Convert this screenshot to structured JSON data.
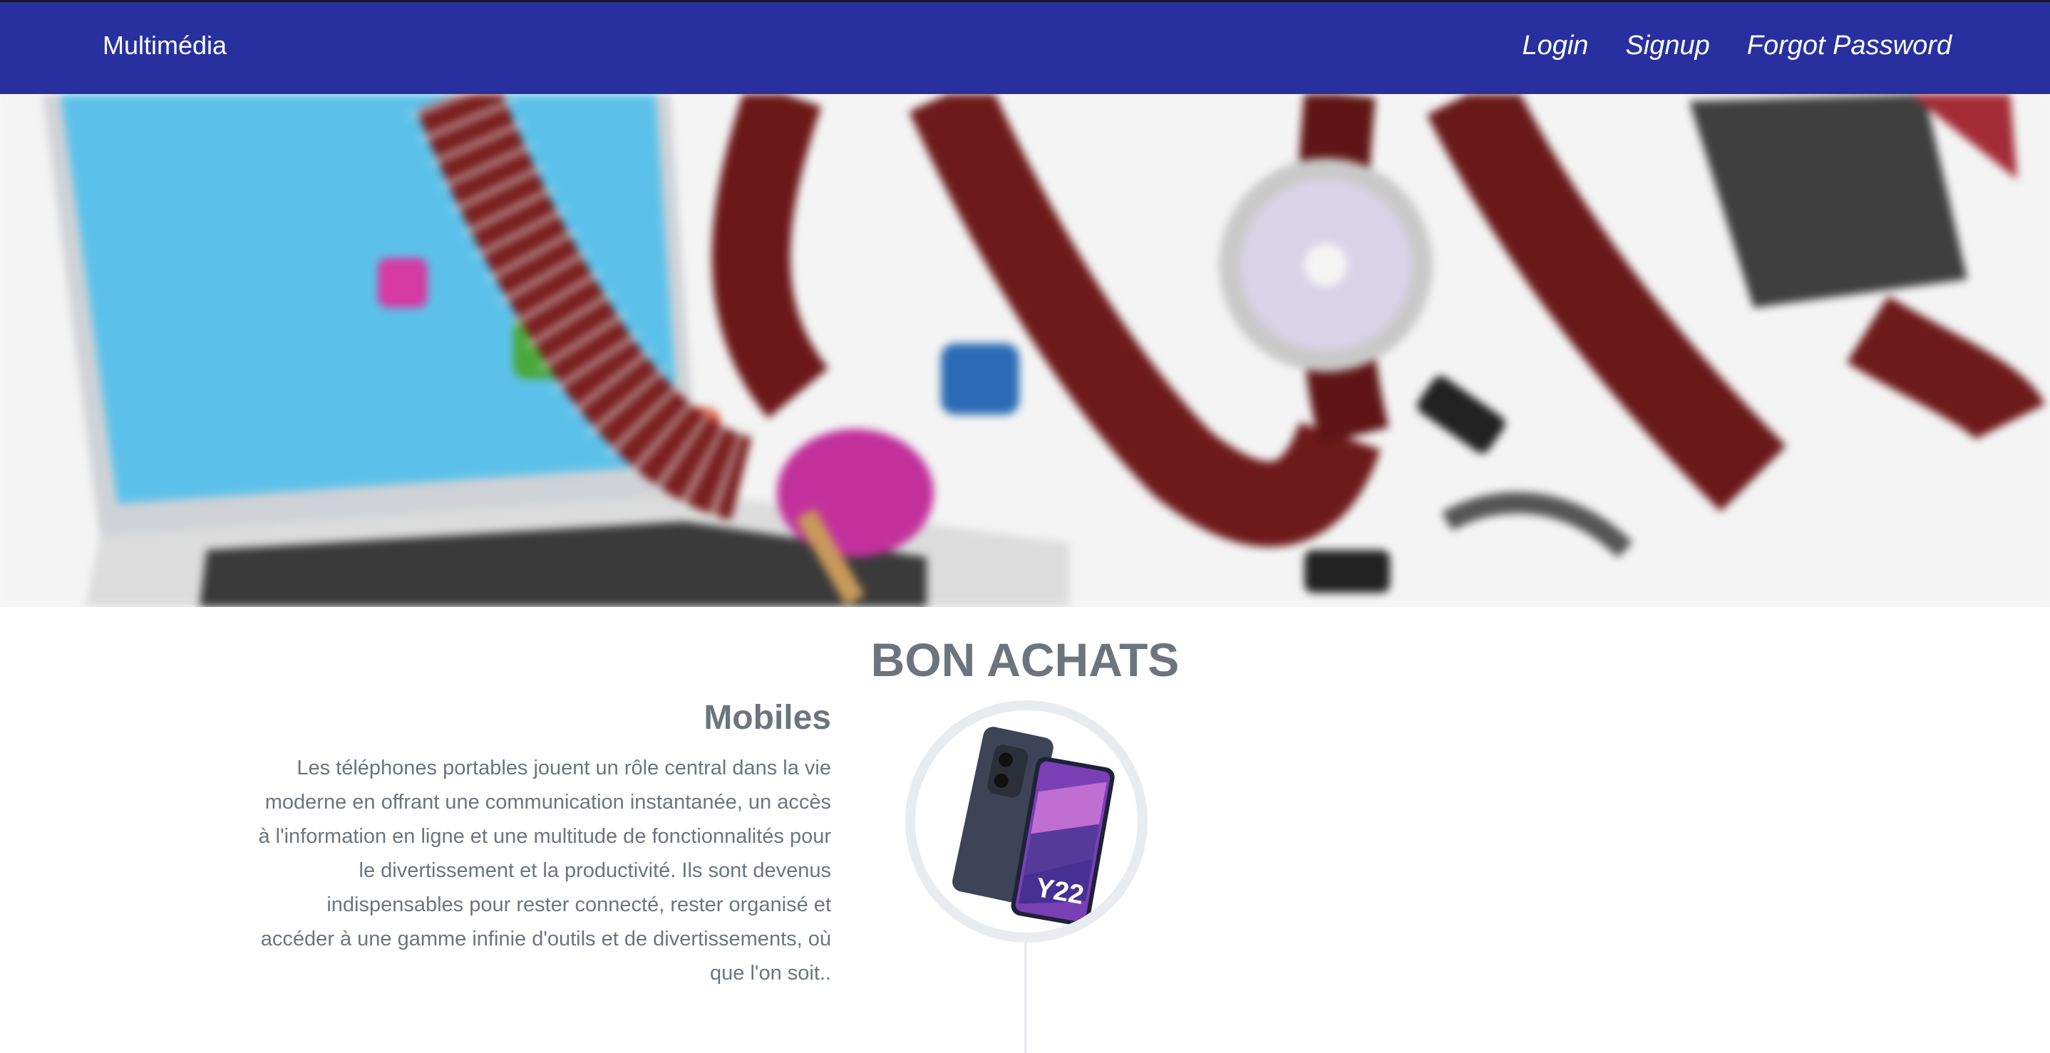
{
  "navbar": {
    "brand": "Multimédia",
    "links": [
      "Login",
      "Signup",
      "Forgot Password"
    ],
    "background": "#2830a0"
  },
  "hero": {
    "image_description_icon": "multimedia-collage-image"
  },
  "page": {
    "title": "BON ACHATS"
  },
  "timeline": {
    "items": [
      {
        "heading": "Mobiles",
        "text": "Les téléphones portables jouent un rôle central dans la vie moderne en offrant une communication instantanée, un accès à l'information en ligne et une multitude de fonctionnalités pour le divertissement et la productivité. Ils sont devenus indispensables pour rester connecté, rester organisé et accéder à une gamme infinie d'outils et de divertissements, où que l'on soit..",
        "image_icon": "vivo-y22-phone-image",
        "phone_label": "Y22"
      }
    ]
  },
  "colors": {
    "text_muted": "#6c757d",
    "circle_border": "#e9ecef"
  }
}
